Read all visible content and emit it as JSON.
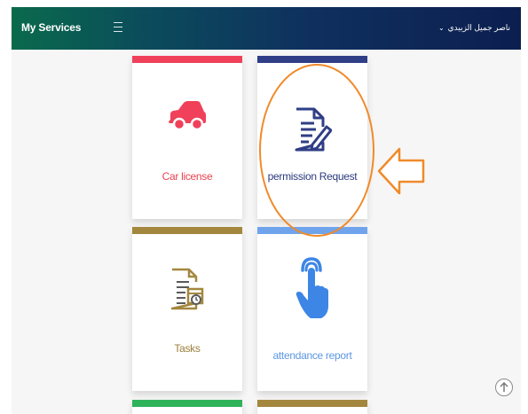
{
  "app": {
    "title": "My Services"
  },
  "header": {
    "user_name": "ناصر جميل الزبيدي",
    "user_chevron_icon": "chevron-down-icon"
  },
  "cards": [
    {
      "label": "Car license",
      "icon": "car-icon",
      "accent": "#f0405a",
      "label_color": "#e8424f"
    },
    {
      "label": "permission Request",
      "icon": "document-edit-icon",
      "accent": "#2f3e86",
      "label_color": "#2c3a7e"
    },
    {
      "label": "Tasks",
      "icon": "task-list-icon",
      "accent": "#a4873e",
      "label_color": "#9b7f3a"
    },
    {
      "label": "attendance report",
      "icon": "touch-finger-icon",
      "accent": "#6fa4ec",
      "label_color": "#5d97e3"
    },
    {
      "label": "",
      "icon": "",
      "accent": "#2fb35a"
    },
    {
      "label": "",
      "icon": "",
      "accent": "#a4873e"
    }
  ],
  "annotation": {
    "highlight_color": "#f08a2a"
  },
  "colors": {
    "header_start": "#0a6a4c",
    "header_end": "#0c1f4f",
    "background": "#f6f6f6"
  }
}
